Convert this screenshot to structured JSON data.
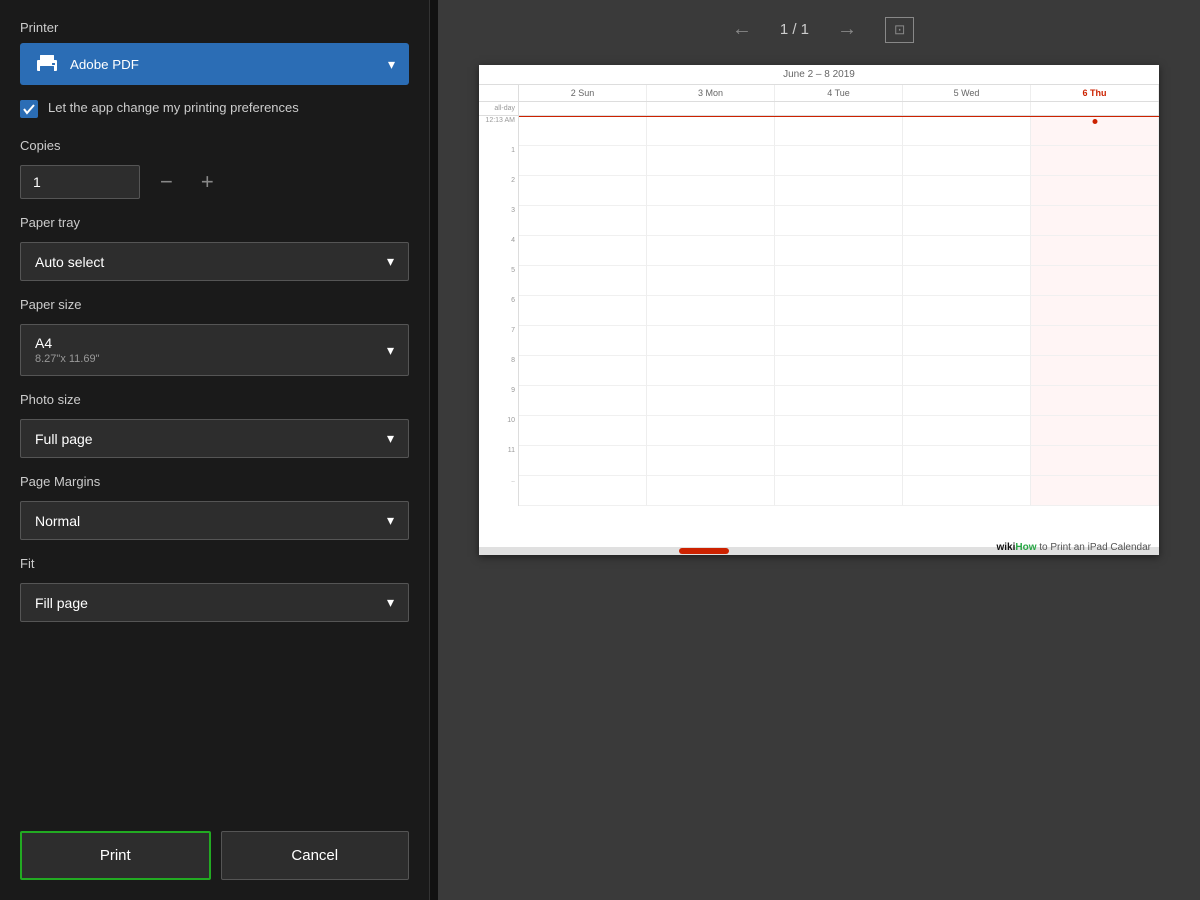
{
  "left_panel": {
    "printer_section": {
      "label": "Printer",
      "printer_name": "Adobe PDF",
      "chevron": "▾"
    },
    "checkbox": {
      "label": "Let the app change my printing preferences",
      "checked": true
    },
    "copies": {
      "label": "Copies",
      "value": "1",
      "minus_label": "−",
      "plus_label": "+"
    },
    "paper_tray": {
      "label": "Paper tray",
      "value": "Auto select",
      "chevron": "▾"
    },
    "paper_size": {
      "label": "Paper size",
      "value": "A4",
      "sub": "8.27\"x 11.69\"",
      "chevron": "▾"
    },
    "photo_size": {
      "label": "Photo size",
      "value": "Full page",
      "chevron": "▾"
    },
    "page_margins": {
      "label": "Page Margins",
      "value": "Normal",
      "chevron": "▾"
    },
    "fit": {
      "label": "Fit",
      "value": "Fill page",
      "chevron": "▾"
    },
    "print_button": "Print",
    "cancel_button": "Cancel"
  },
  "right_panel": {
    "nav": {
      "prev_arrow": "←",
      "next_arrow": "→",
      "page_indicator": "1 / 1",
      "fit_icon": "⊡"
    },
    "calendar": {
      "header_text": "June 2 – 8 2019",
      "days": [
        {
          "num": "2",
          "name": "Sun"
        },
        {
          "num": "3",
          "name": "Mon"
        },
        {
          "num": "4",
          "name": "Tue"
        },
        {
          "num": "5",
          "name": "Wed"
        },
        {
          "num": "6",
          "name": "Thu",
          "today": true
        }
      ],
      "allday_label": "all-day",
      "time_label_start": "12:13 AM",
      "time_slots": [
        "1",
        "2",
        "3",
        "4",
        "5",
        "6",
        "7",
        "8",
        "9",
        "10",
        "11",
        ".."
      ]
    }
  },
  "watermark": {
    "wiki": "wiki",
    "how": "How",
    "text": " to Print an iPad Calendar"
  }
}
